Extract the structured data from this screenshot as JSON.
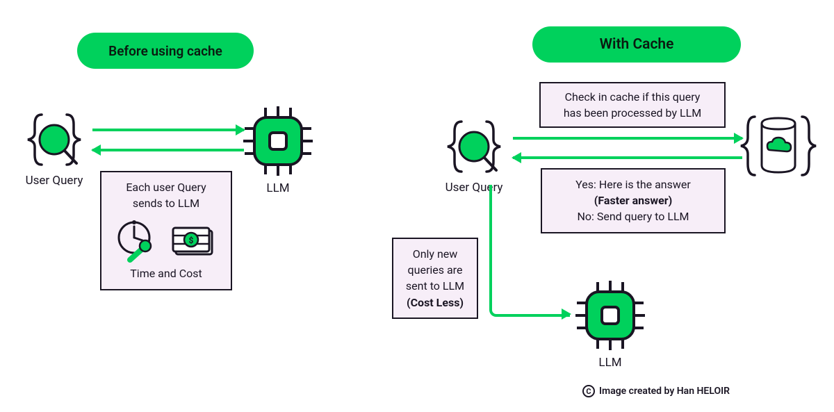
{
  "left": {
    "title": "Before using cache",
    "user_query_label": "User Query",
    "llm_label": "LLM",
    "box_line1": "Each user Query",
    "box_line2": "sends to LLM",
    "box_line3": "Time  and Cost"
  },
  "right": {
    "title": "With Cache",
    "user_query_label": "User Query",
    "llm_label": "LLM",
    "check_box_l1": "Check in cache if this query",
    "check_box_l2": "has been processed by LLM",
    "answer_box_l1": "Yes: Here is the answer",
    "answer_box_l2": "(Faster answer)",
    "answer_box_l3": "No: Send query to LLM",
    "newq_box_l1": "Only new",
    "newq_box_l2": "queries are",
    "newq_box_l3": "sent to LLM",
    "newq_box_l4": "(Cost Less)"
  },
  "credit": "Image created by Han HELOIR",
  "colors": {
    "accent": "#00d15c",
    "box": "#f7eef8",
    "ink": "#1a1523"
  }
}
